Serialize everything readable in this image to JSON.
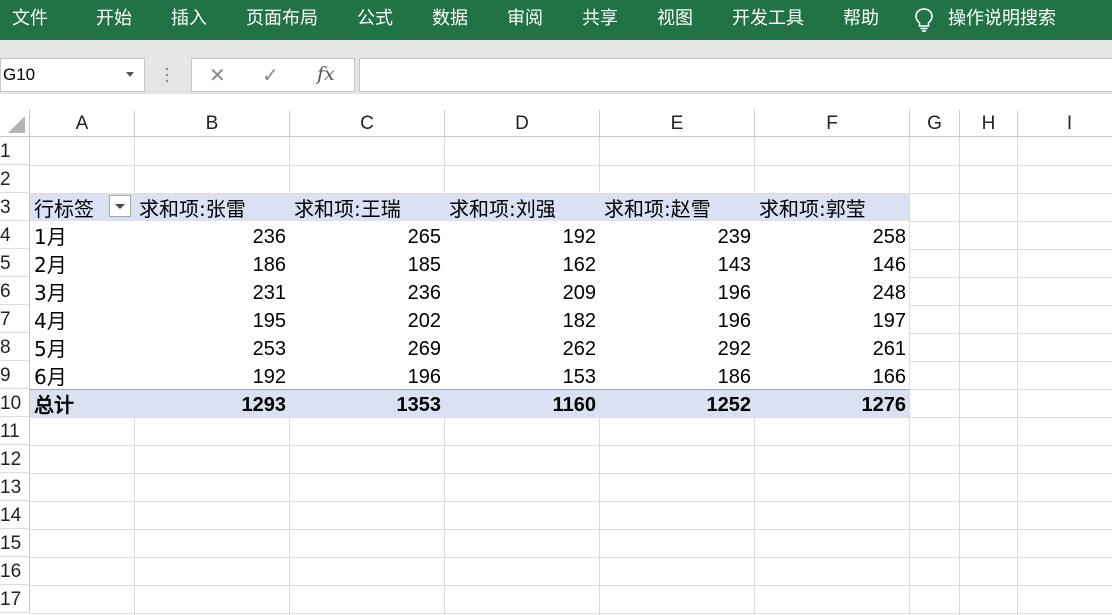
{
  "ribbon": {
    "tabs": [
      "文件",
      "开始",
      "插入",
      "页面布局",
      "公式",
      "数据",
      "审阅",
      "共享",
      "视图",
      "开发工具",
      "帮助"
    ],
    "search": "操作说明搜索"
  },
  "formula_bar": {
    "name_box": "G10",
    "fx": "fx",
    "value": ""
  },
  "columns": [
    "A",
    "B",
    "C",
    "D",
    "E",
    "F",
    "G",
    "H",
    "I"
  ],
  "rows": [
    "1",
    "2",
    "3",
    "4",
    "5",
    "6",
    "7",
    "8",
    "9",
    "10",
    "11",
    "12",
    "13",
    "14",
    "15",
    "16",
    "17"
  ],
  "pivot": {
    "row_label_header": "行标签",
    "value_headers": [
      "求和项:张雷",
      "求和项:王瑞",
      "求和项:刘强",
      "求和项:赵雪",
      "求和项:郭莹"
    ],
    "data": [
      {
        "label": "1月",
        "values": [
          "236",
          "265",
          "192",
          "239",
          "258"
        ]
      },
      {
        "label": "2月",
        "values": [
          "186",
          "185",
          "162",
          "143",
          "146"
        ]
      },
      {
        "label": "3月",
        "values": [
          "231",
          "236",
          "209",
          "196",
          "248"
        ]
      },
      {
        "label": "4月",
        "values": [
          "195",
          "202",
          "182",
          "196",
          "197"
        ]
      },
      {
        "label": "5月",
        "values": [
          "253",
          "269",
          "262",
          "292",
          "261"
        ]
      },
      {
        "label": "6月",
        "values": [
          "192",
          "196",
          "153",
          "186",
          "166"
        ]
      }
    ],
    "total_label": "总计",
    "totals": [
      "1293",
      "1353",
      "1160",
      "1252",
      "1276"
    ]
  },
  "colors": {
    "ribbon": "#217346",
    "pivot_band": "#d9e1f2"
  }
}
